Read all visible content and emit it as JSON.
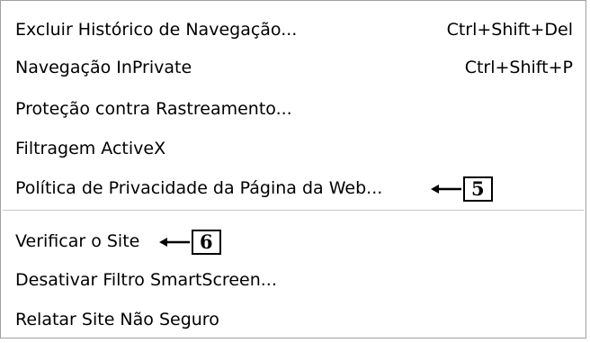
{
  "menu": {
    "items": [
      {
        "label": "Excluir Histórico de Navegação...",
        "shortcut": "Ctrl+Shift+Del"
      },
      {
        "label": "Navegação InPrivate",
        "shortcut": "Ctrl+Shift+P"
      },
      {
        "label": "Proteção contra Rastreamento..."
      },
      {
        "label": "Filtragem ActiveX"
      },
      {
        "label": "Política de Privacidade da Página da Web..."
      },
      {
        "label": "Verificar o Site"
      },
      {
        "label": "Desativar Filtro SmartScreen..."
      },
      {
        "label": "Relatar Site Não Seguro"
      }
    ]
  },
  "annotations": {
    "callout_5": "5",
    "callout_6": "6"
  }
}
